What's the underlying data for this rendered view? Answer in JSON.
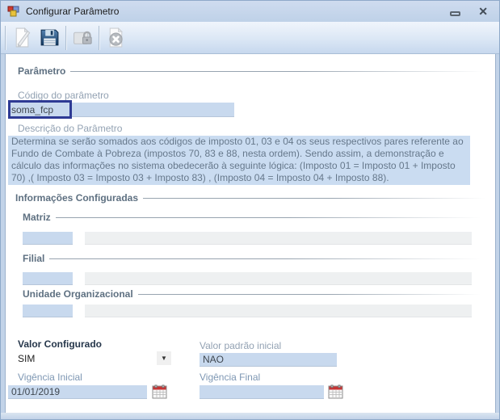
{
  "window": {
    "title": "Configurar Parâmetro",
    "controls": {
      "minimize": "minimize",
      "close": "close"
    }
  },
  "toolbar": {
    "buttons": [
      {
        "name": "edit",
        "icon": "pencil-page-icon",
        "enabled": false
      },
      {
        "name": "save",
        "icon": "floppy-disk-icon",
        "enabled": true
      },
      {
        "name": "lock",
        "icon": "padlock-box-icon",
        "enabled": false
      },
      {
        "name": "cancel",
        "icon": "page-x-icon",
        "enabled": false
      }
    ]
  },
  "parametro": {
    "section_title": "Parâmetro",
    "codigo_label": "Código do parâmetro",
    "codigo_value": "soma_fcp",
    "descricao_label": "Descrição do Parâmetro",
    "descricao_value": "Determina se serão somados aos códigos de imposto 01, 03 e 04 os seus respectivos pares referente ao Fundo de Combate à Pobreza (impostos 70, 83 e 88, nesta ordem). Sendo assim, a demonstração e cálculo das informações no sistema obedecerão à seguinte lógica: (Imposto 01 = Imposto 01 + Imposto 70) ,( Imposto 03 = Imposto 03 + Imposto 83) , (Imposto 04 = Imposto 04 + Imposto 88)."
  },
  "informacoes": {
    "section_title": "Informações Configuradas",
    "matriz_label": "Matriz",
    "matriz_code": "",
    "matriz_name": "",
    "filial_label": "Filial",
    "filial_code": "",
    "filial_name": "",
    "unidade_label": "Unidade Organizacional",
    "unidade_code": "",
    "unidade_name": ""
  },
  "valores": {
    "valor_configurado_label": "Valor Configurado",
    "valor_configurado_value": "SIM",
    "valor_padrao_label": "Valor padrão inicial",
    "valor_padrao_value": "NAO",
    "vigencia_inicial_label": "Vigência Inicial",
    "vigencia_inicial_value": "01/01/2019",
    "vigencia_final_label": "Vigência Final",
    "vigencia_final_value": ""
  },
  "colors": {
    "titlebar": "#c6d6eb",
    "toolbar_gradient_bottom": "#c7d8ee",
    "field_blue": "#c8d9ee",
    "field_gray": "#eef0f1",
    "description_bg": "#cadcf1",
    "focus_border": "#2e3a94",
    "section_header_text": "#5e7081",
    "label_gray": "#93a2b3",
    "calendar_red": "#c63535",
    "save_icon_blue": "#1c4a75"
  }
}
